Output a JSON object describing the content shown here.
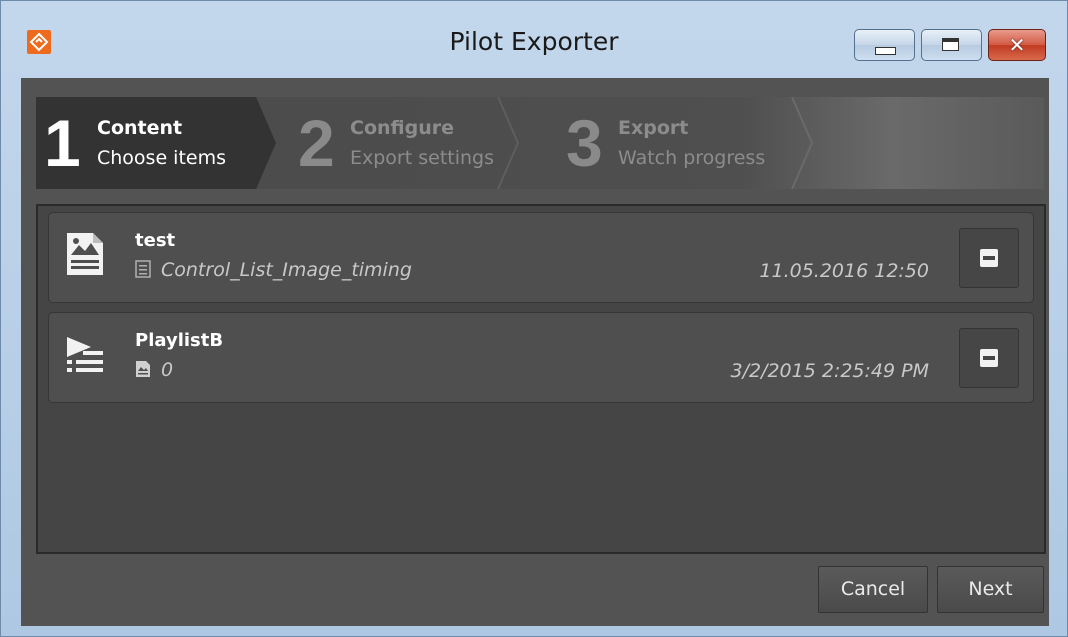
{
  "window": {
    "title": "Pilot Exporter"
  },
  "wizard": {
    "steps": [
      {
        "number": "1",
        "title": "Content",
        "subtitle": "Choose items",
        "state": "active"
      },
      {
        "number": "2",
        "title": "Configure",
        "subtitle": "Export settings",
        "state": "inactive"
      },
      {
        "number": "3",
        "title": "Export",
        "subtitle": "Watch progress",
        "state": "inactive"
      }
    ]
  },
  "items": [
    {
      "name": "test",
      "detail": "Control_List_Image_timing",
      "date": "11.05.2016 12:50",
      "icon": "image-document-icon",
      "detail_icon": "control-list-icon"
    },
    {
      "name": "PlaylistB",
      "detail": "0",
      "date": "3/2/2015 2:25:49 PM",
      "icon": "playlist-icon",
      "detail_icon": "image-document-icon"
    }
  ],
  "buttons": {
    "cancel": "Cancel",
    "next": "Next"
  },
  "colors": {
    "accent": "#ee6b1e",
    "panel": "#535353",
    "close": "#c13a22"
  }
}
